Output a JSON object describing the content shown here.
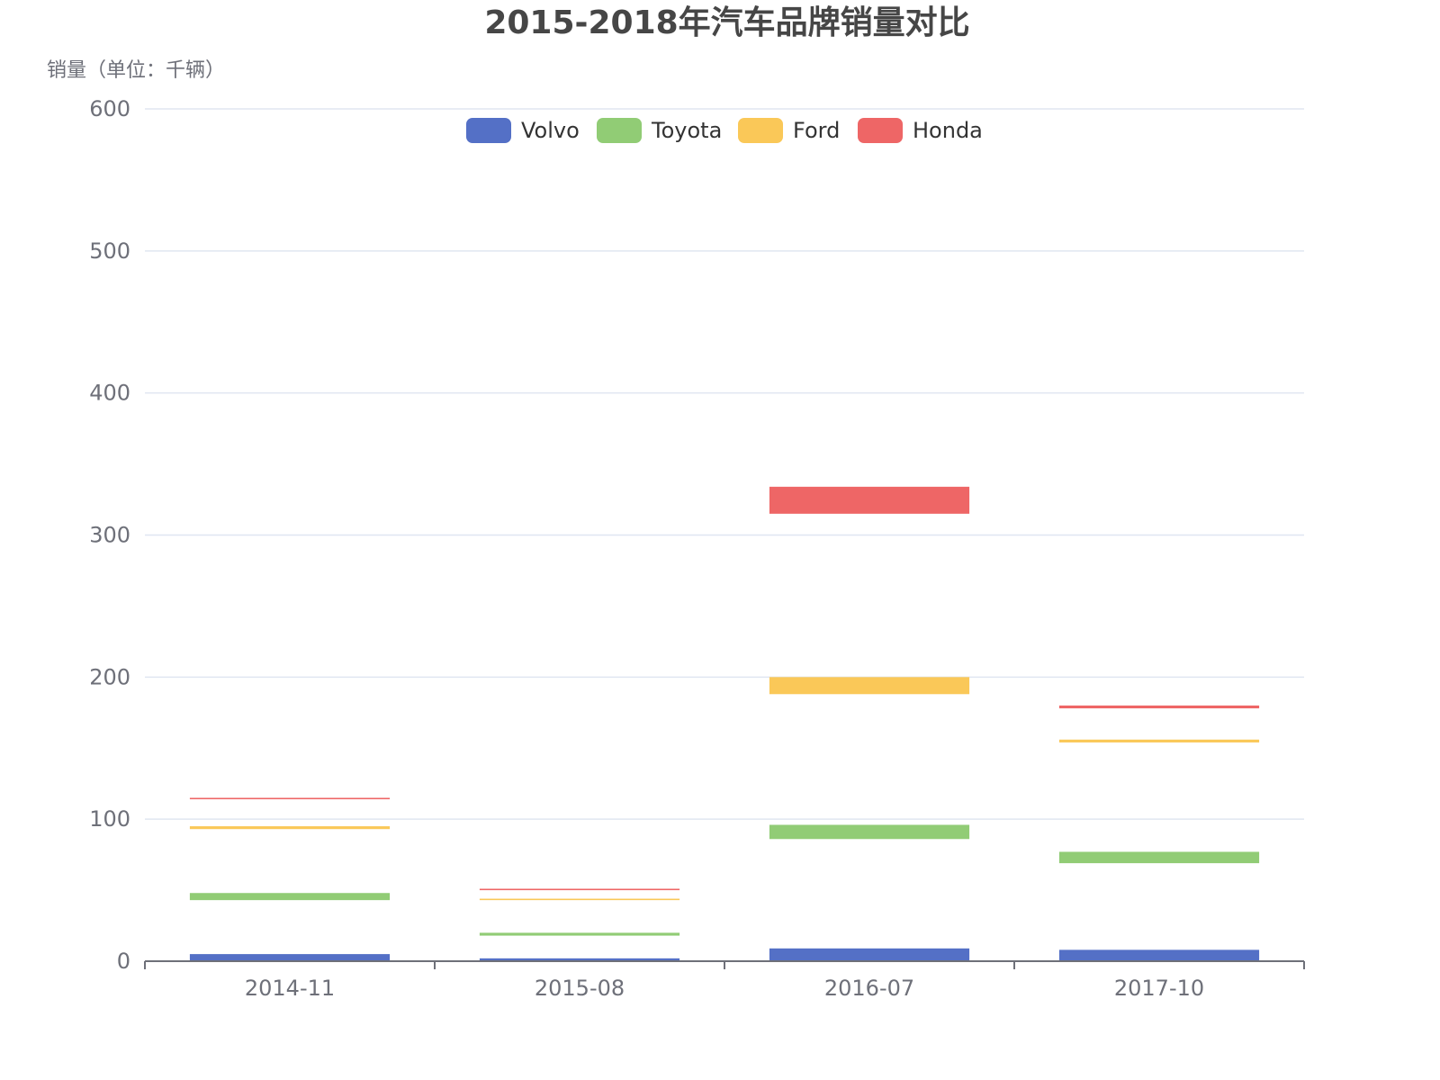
{
  "chart_data": {
    "type": "bar",
    "title": "2015-2018年汽车品牌销量对比",
    "ylabel": "销量（单位：千辆）",
    "xlabel": "",
    "categories": [
      "2014-11",
      "2015-08",
      "2016-07",
      "2017-10"
    ],
    "ylim": [
      0,
      600
    ],
    "yticks": [
      0,
      100,
      200,
      300,
      400,
      500,
      600
    ],
    "grid": true,
    "legend_position": "top-center",
    "series": [
      {
        "name": "Volvo",
        "color": "#5470C6",
        "ranges": [
          [
            0,
            5
          ],
          [
            0,
            2
          ],
          [
            0,
            9
          ],
          [
            0,
            8
          ]
        ]
      },
      {
        "name": "Toyota",
        "color": "#91CC75",
        "ranges": [
          [
            43,
            48
          ],
          [
            18,
            20
          ],
          [
            86,
            96
          ],
          [
            69,
            77
          ]
        ]
      },
      {
        "name": "Ford",
        "color": "#FAC858",
        "ranges": [
          [
            93,
            95
          ],
          [
            43,
            44
          ],
          [
            188,
            200
          ],
          [
            154,
            156
          ]
        ]
      },
      {
        "name": "Honda",
        "color": "#EE6666",
        "ranges": [
          [
            114,
            115
          ],
          [
            50,
            51
          ],
          [
            315,
            334
          ],
          [
            178,
            180
          ]
        ]
      }
    ]
  }
}
